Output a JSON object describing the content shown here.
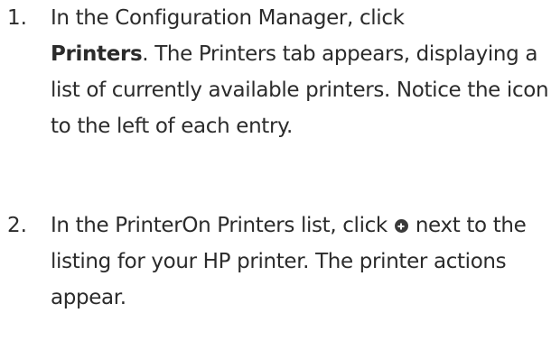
{
  "steps": [
    {
      "number": "1.",
      "text_before": "In the Configuration Manager, click",
      "bold": "Printers",
      "text_after": ". The Printers tab appears, displaying a list of currently available printers. Notice the icon to the left of each entry."
    },
    {
      "number": "2.",
      "text_before": "In the PrinterOn Printers list, click",
      "icon": "plus-circle-icon",
      "text_after": "next to the listing for your HP printer. The printer actions appear."
    }
  ]
}
